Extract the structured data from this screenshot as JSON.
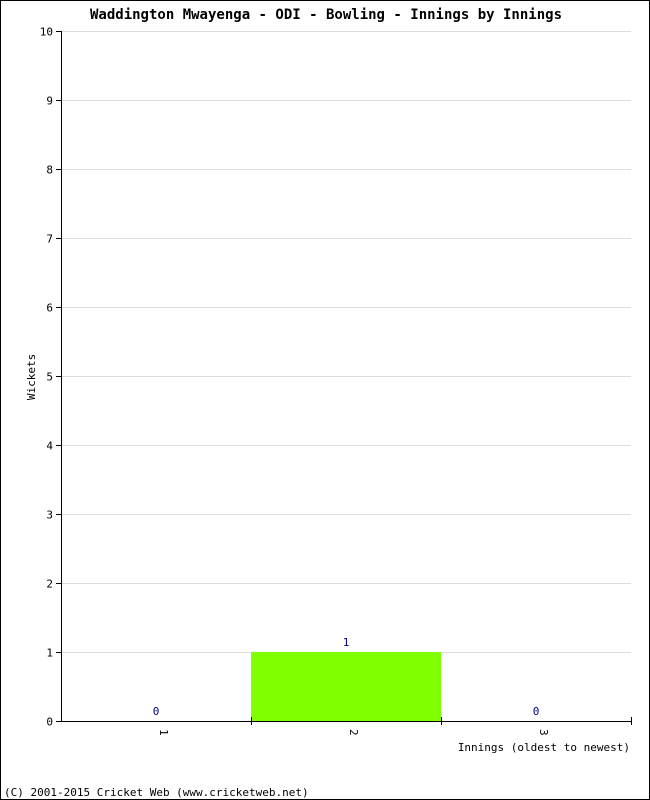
{
  "chart_data": {
    "type": "bar",
    "title": "Waddington Mwayenga - ODI - Bowling - Innings by Innings",
    "xlabel": "Innings (oldest to newest)",
    "ylabel": "Wickets",
    "categories": [
      "1",
      "2",
      "3"
    ],
    "values": [
      0,
      1,
      0
    ],
    "data_labels": [
      "0",
      "1",
      "0"
    ],
    "ylim": [
      0,
      10
    ],
    "yticks": [
      0,
      1,
      2,
      3,
      4,
      5,
      6,
      7,
      8,
      9,
      10
    ],
    "grid": true,
    "legend": "none",
    "bar_color": "#7fff00",
    "label_color": "#000080"
  },
  "footer": {
    "copyright": "(C) 2001-2015 Cricket Web (www.cricketweb.net)"
  }
}
